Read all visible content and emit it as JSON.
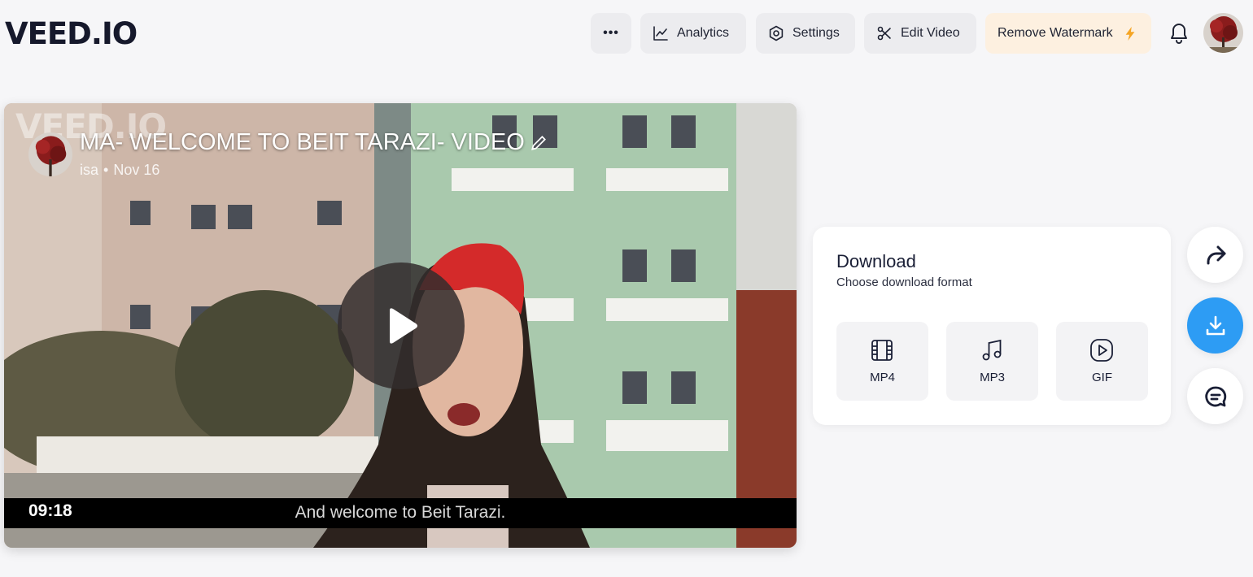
{
  "brand": {
    "logo": "VEED.IO"
  },
  "header": {
    "more_label": "•••",
    "analytics_label": "Analytics",
    "settings_label": "Settings",
    "edit_label": "Edit Video",
    "watermark_label": "Remove Watermark",
    "accent_color": "#f5a524"
  },
  "video": {
    "watermark": "VEED.IO",
    "title": "MA- WELCOME TO BEIT TARAZI- VIDEO",
    "author": "isa",
    "date": "Nov 16",
    "timestamp": "09:18",
    "subtitle": "And welcome to Beit Tarazi."
  },
  "download": {
    "title": "Download",
    "subtitle": "Choose download format",
    "formats": [
      {
        "label": "MP4",
        "icon": "film-icon"
      },
      {
        "label": "MP3",
        "icon": "music-note-icon"
      },
      {
        "label": "GIF",
        "icon": "play-circle-icon"
      }
    ]
  },
  "side_actions": [
    {
      "icon": "share-arrow-icon"
    },
    {
      "icon": "download-icon",
      "color": "#2d9cf4"
    },
    {
      "icon": "comment-icon"
    }
  ]
}
